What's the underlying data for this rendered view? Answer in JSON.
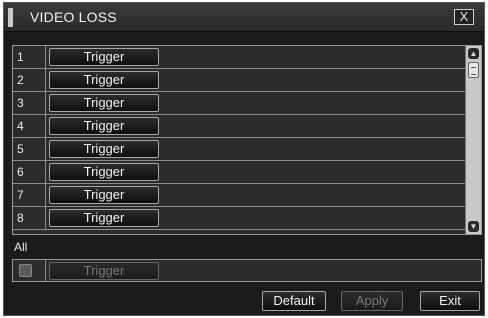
{
  "dialog": {
    "title": "VIDEO LOSS",
    "close_label": "X"
  },
  "channels": [
    {
      "num": "1",
      "action": "Trigger"
    },
    {
      "num": "2",
      "action": "Trigger"
    },
    {
      "num": "3",
      "action": "Trigger"
    },
    {
      "num": "4",
      "action": "Trigger"
    },
    {
      "num": "5",
      "action": "Trigger"
    },
    {
      "num": "6",
      "action": "Trigger"
    },
    {
      "num": "7",
      "action": "Trigger"
    },
    {
      "num": "8",
      "action": "Trigger"
    }
  ],
  "all": {
    "label": "All",
    "checked": false,
    "action": "Trigger"
  },
  "footer": {
    "default_label": "Default",
    "apply_label": "Apply",
    "exit_label": "Exit"
  },
  "scrollbar": {
    "up_icon": "scroll-up-arrow",
    "down_icon": "scroll-down-arrow"
  }
}
